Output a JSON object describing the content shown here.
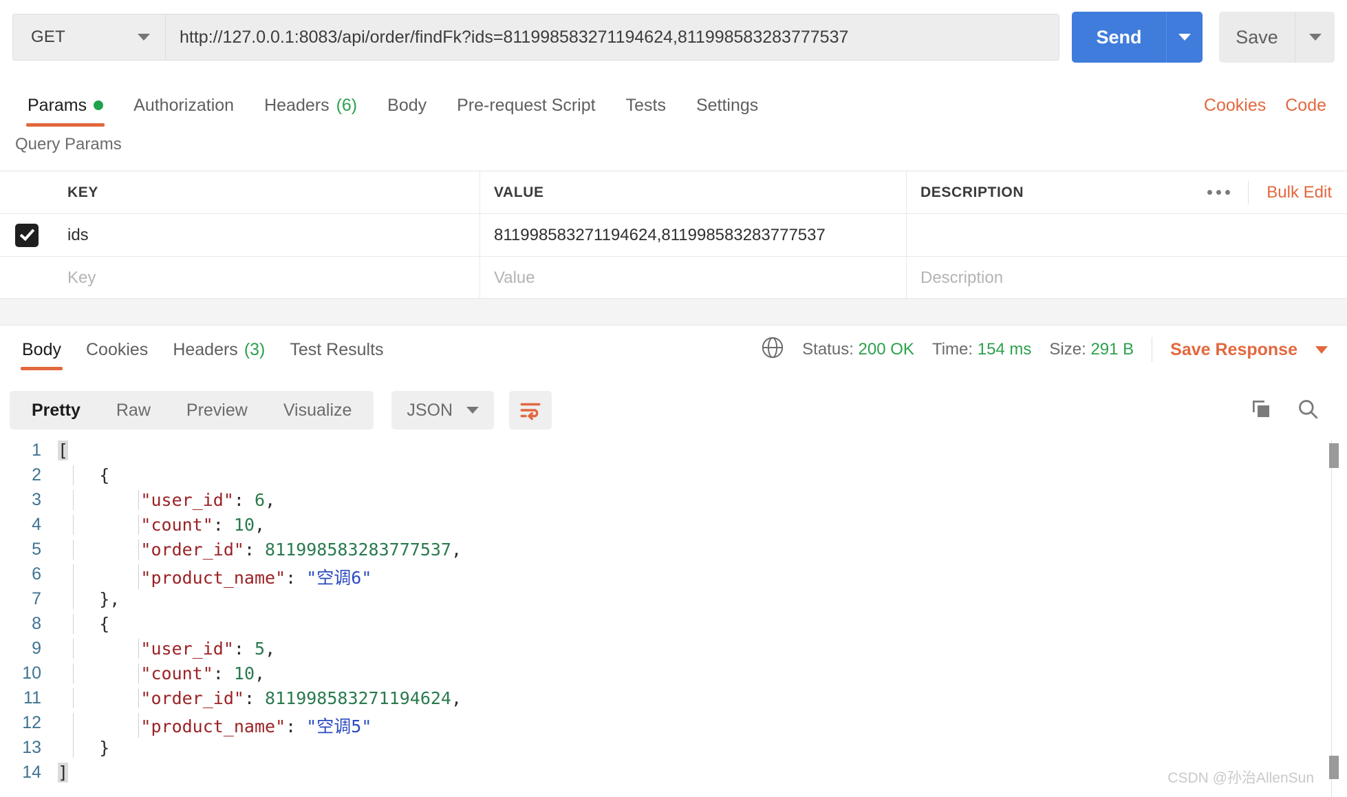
{
  "request": {
    "method": "GET",
    "url": "http://127.0.0.1:8083/api/order/findFk?ids=811998583271194624,811998583283777537",
    "send_label": "Send",
    "save_label": "Save",
    "tabs": [
      {
        "label": "Params",
        "badge": "",
        "dot": true,
        "active": true
      },
      {
        "label": "Authorization",
        "badge": "",
        "dot": false,
        "active": false
      },
      {
        "label": "Headers",
        "badge": "(6)",
        "dot": false,
        "active": false
      },
      {
        "label": "Body",
        "badge": "",
        "dot": false,
        "active": false
      },
      {
        "label": "Pre-request Script",
        "badge": "",
        "dot": false,
        "active": false
      },
      {
        "label": "Tests",
        "badge": "",
        "dot": false,
        "active": false
      },
      {
        "label": "Settings",
        "badge": "",
        "dot": false,
        "active": false
      }
    ],
    "cookies_label": "Cookies",
    "code_label": "Code"
  },
  "query_params": {
    "title": "Query Params",
    "columns": [
      "KEY",
      "VALUE",
      "DESCRIPTION"
    ],
    "bulk_edit_label": "Bulk Edit",
    "rows": [
      {
        "checked": true,
        "key": "ids",
        "value": "811998583271194624,811998583283777537",
        "description": ""
      }
    ],
    "placeholders": {
      "key": "Key",
      "value": "Value",
      "description": "Description"
    }
  },
  "response": {
    "tabs": [
      {
        "label": "Body",
        "badge": "",
        "active": true
      },
      {
        "label": "Cookies",
        "badge": "",
        "active": false
      },
      {
        "label": "Headers",
        "badge": "(3)",
        "active": false
      },
      {
        "label": "Test Results",
        "badge": "",
        "active": false
      }
    ],
    "status_label": "Status:",
    "status_value": "200 OK",
    "time_label": "Time:",
    "time_value": "154 ms",
    "size_label": "Size:",
    "size_value": "291 B",
    "save_response_label": "Save Response",
    "view_modes": [
      {
        "label": "Pretty",
        "active": true
      },
      {
        "label": "Raw",
        "active": false
      },
      {
        "label": "Preview",
        "active": false
      },
      {
        "label": "Visualize",
        "active": false
      }
    ],
    "format": "JSON",
    "body_lines": [
      {
        "n": "1",
        "indent": 0,
        "tokens": [
          {
            "t": "[",
            "c": "brk"
          }
        ]
      },
      {
        "n": "2",
        "indent": 1,
        "tokens": [
          {
            "t": "{",
            "c": "p"
          }
        ]
      },
      {
        "n": "3",
        "indent": 2,
        "tokens": [
          {
            "t": "\"user_id\"",
            "c": "k"
          },
          {
            "t": ": ",
            "c": "p"
          },
          {
            "t": "6",
            "c": "n"
          },
          {
            "t": ",",
            "c": "p"
          }
        ]
      },
      {
        "n": "4",
        "indent": 2,
        "tokens": [
          {
            "t": "\"count\"",
            "c": "k"
          },
          {
            "t": ": ",
            "c": "p"
          },
          {
            "t": "10",
            "c": "n"
          },
          {
            "t": ",",
            "c": "p"
          }
        ]
      },
      {
        "n": "5",
        "indent": 2,
        "tokens": [
          {
            "t": "\"order_id\"",
            "c": "k"
          },
          {
            "t": ": ",
            "c": "p"
          },
          {
            "t": "811998583283777537",
            "c": "n"
          },
          {
            "t": ",",
            "c": "p"
          }
        ]
      },
      {
        "n": "6",
        "indent": 2,
        "tokens": [
          {
            "t": "\"product_name\"",
            "c": "k"
          },
          {
            "t": ": ",
            "c": "p"
          },
          {
            "t": "\"空调6\"",
            "c": "s"
          }
        ]
      },
      {
        "n": "7",
        "indent": 1,
        "tokens": [
          {
            "t": "},",
            "c": "p"
          }
        ]
      },
      {
        "n": "8",
        "indent": 1,
        "tokens": [
          {
            "t": "{",
            "c": "p"
          }
        ]
      },
      {
        "n": "9",
        "indent": 2,
        "tokens": [
          {
            "t": "\"user_id\"",
            "c": "k"
          },
          {
            "t": ": ",
            "c": "p"
          },
          {
            "t": "5",
            "c": "n"
          },
          {
            "t": ",",
            "c": "p"
          }
        ]
      },
      {
        "n": "10",
        "indent": 2,
        "tokens": [
          {
            "t": "\"count\"",
            "c": "k"
          },
          {
            "t": ": ",
            "c": "p"
          },
          {
            "t": "10",
            "c": "n"
          },
          {
            "t": ",",
            "c": "p"
          }
        ]
      },
      {
        "n": "11",
        "indent": 2,
        "tokens": [
          {
            "t": "\"order_id\"",
            "c": "k"
          },
          {
            "t": ": ",
            "c": "p"
          },
          {
            "t": "811998583271194624",
            "c": "n"
          },
          {
            "t": ",",
            "c": "p"
          }
        ]
      },
      {
        "n": "12",
        "indent": 2,
        "tokens": [
          {
            "t": "\"product_name\"",
            "c": "k"
          },
          {
            "t": ": ",
            "c": "p"
          },
          {
            "t": "\"空调5\"",
            "c": "s"
          }
        ]
      },
      {
        "n": "13",
        "indent": 1,
        "tokens": [
          {
            "t": "}",
            "c": "p"
          }
        ]
      },
      {
        "n": "14",
        "indent": 0,
        "tokens": [
          {
            "t": "]",
            "c": "brk"
          }
        ]
      }
    ]
  },
  "icons": {
    "method_caret": "chevron-down-icon",
    "send_caret": "chevron-down-icon",
    "save_caret": "chevron-down-icon",
    "globe": "globe-icon",
    "wrap": "word-wrap-icon",
    "copy": "copy-icon",
    "search": "search-icon",
    "ellipsis": "ellipsis-icon"
  },
  "watermark": "CSDN @孙治AllenSun",
  "colors": {
    "accent_orange": "#e2683e",
    "send_blue": "#3f7cdb",
    "status_green": "#2ca14c"
  }
}
